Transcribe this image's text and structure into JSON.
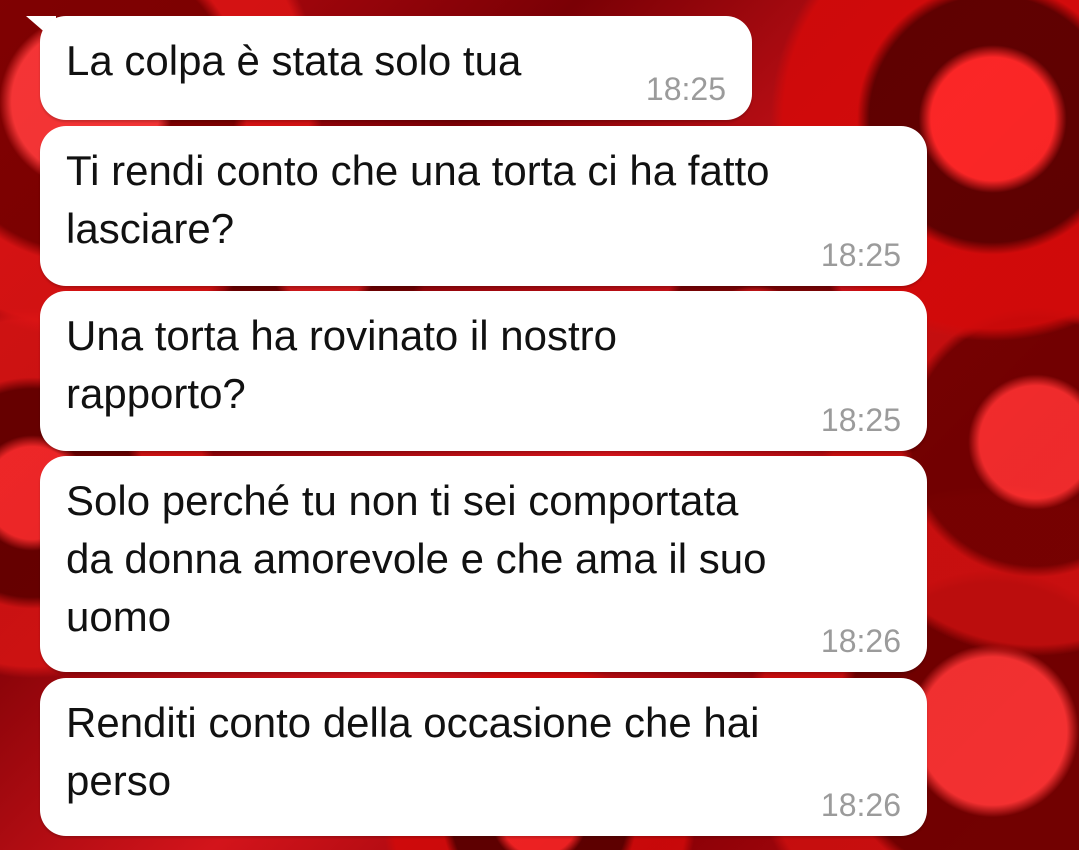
{
  "chat": {
    "messages": [
      {
        "text": "La colpa è stata solo tua",
        "time": "18:25"
      },
      {
        "text": "Ti rendi conto che una torta ci ha fatto\nlasciare?",
        "time": "18:25"
      },
      {
        "text": "Una torta ha rovinato il nostro\nrapporto?",
        "time": "18:25"
      },
      {
        "text": "Solo perché tu non ti sei comportata\nda donna amorevole e che ama il suo\nuomo",
        "time": "18:26"
      },
      {
        "text": "Renditi conto della occasione che hai\nperso",
        "time": "18:26"
      }
    ],
    "colors": {
      "bubble": "#ffffff",
      "text": "#111111",
      "time": "#9b9b9b",
      "background": "#c40b12"
    }
  }
}
